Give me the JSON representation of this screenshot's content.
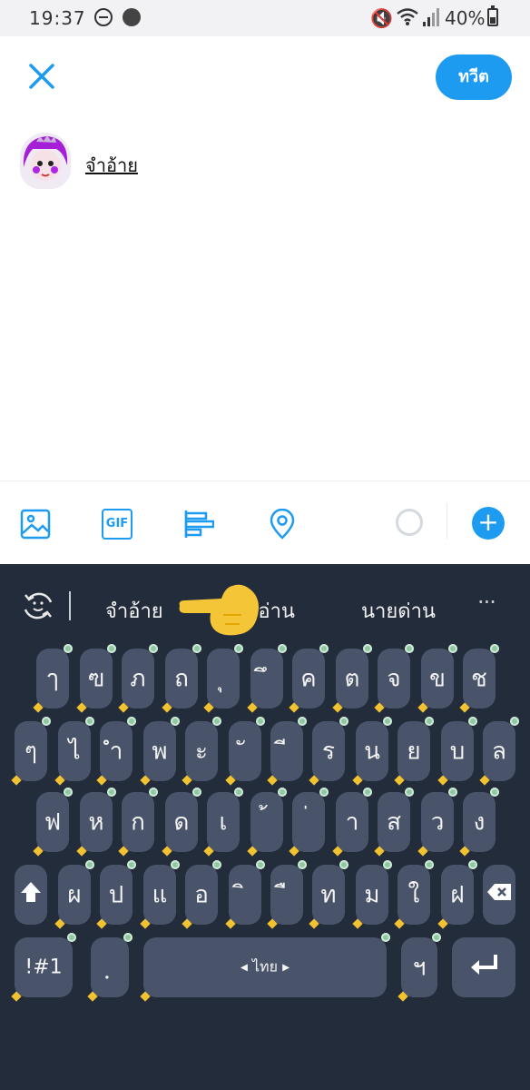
{
  "status_bar": {
    "time": "19:37",
    "battery": "40%"
  },
  "compose": {
    "close_icon": "close-icon",
    "tweet_button_label": "ทวีต",
    "text": "จำอ้าย",
    "colors": {
      "accent": "#1d9bf0"
    }
  },
  "toolbar": {
    "gif_label": "GIF",
    "icons": [
      "image-icon",
      "gif-icon",
      "poll-icon",
      "location-icon"
    ],
    "add_label": "+"
  },
  "keyboard": {
    "suggestions": [
      "จำอ้าย",
      "าอ่าน",
      "นายด่าน"
    ],
    "more": "···",
    "rows": [
      [
        "ๅ",
        "ฃ",
        "ภ",
        "ถ",
        "ุ",
        "ึ",
        "ค",
        "ต",
        "จ",
        "ข",
        "ช"
      ],
      [
        "ๆ",
        "ไ",
        "ำ",
        "พ",
        "ะ",
        "ั",
        "ี",
        "ร",
        "น",
        "ย",
        "บ",
        "ล"
      ],
      [
        "ฟ",
        "ห",
        "ก",
        "ด",
        "เ",
        "้",
        "่",
        "า",
        "ส",
        "ว",
        "ง"
      ],
      [
        "ผ",
        "ป",
        "แ",
        "อ",
        "ิ",
        "ื",
        "ท",
        "ม",
        "ใ",
        "ฝ"
      ]
    ],
    "symbols_label": "!#1",
    "comma_key": "ฺ",
    "space_label": "◂ ไทย ▸",
    "period_key": "ฯ",
    "colors": {
      "background": "#232c3b",
      "key": "#49546a"
    }
  }
}
